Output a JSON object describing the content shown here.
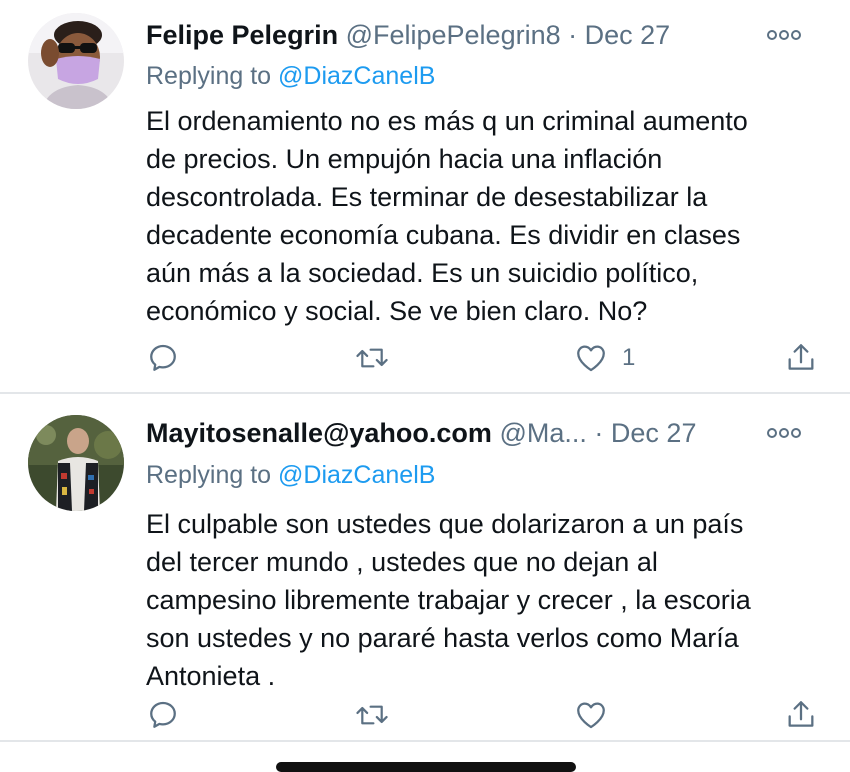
{
  "tweets": [
    {
      "name": "Felipe Pelegrin",
      "handle": "@FelipePelegrin8",
      "separator": "·",
      "date": "Dec 27",
      "replying_prefix": "Replying to",
      "replying_handle": "@DiazCanelB",
      "text_lines": [
        "El ordenamiento no es más q un criminal aumento",
        "de precios. Un empujón hacia una inflación",
        "descontrolada. Es terminar de desestabilizar la",
        "decadente economía cubana. Es dividir en clases",
        "aún más a la sociedad. Es un suicidio político,",
        "económico y social. Se ve bien claro. No?"
      ],
      "like_count": "1",
      "avatar_icon": "avatar-person-sunglasses-mask",
      "more_icon": "more-options-icon"
    },
    {
      "name": "Mayitosenalle@yahoo.com",
      "handle": "@Ma...",
      "separator": "·",
      "date": "Dec 27",
      "replying_prefix": "Replying to",
      "replying_handle": "@DiazCanelB",
      "text_lines": [
        "El culpable son ustedes que dolarizaron a un país",
        "del tercer mundo , ustedes que no dejan al",
        "campesino libremente trabajar y crecer , la escoria",
        "son ustedes y no pararé hasta verlos como María",
        "Antonieta ."
      ],
      "like_count": "",
      "avatar_icon": "avatar-person-vest",
      "more_icon": "more-options-icon"
    }
  ],
  "colors": {
    "text": "#0f1419",
    "secondary": "#5b7083",
    "link": "#1d9bf0",
    "divider": "#e3e6e9"
  }
}
